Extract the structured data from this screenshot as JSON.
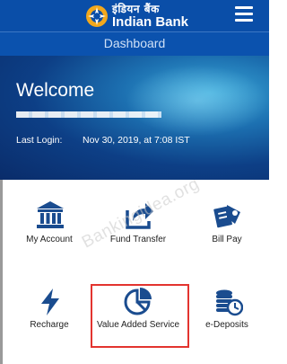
{
  "header": {
    "logo_hindi": "इंडियन बैंक",
    "logo_english": "Indian Bank",
    "menu_icon": "hamburger-menu-icon",
    "brand_color": "#0a4ea8"
  },
  "subheader": {
    "title": "Dashboard"
  },
  "hero": {
    "welcome_text": "Welcome",
    "last_login_label": "Last Login:",
    "last_login_value": "Nov 30, 2019, at 7:08 IST"
  },
  "tiles": [
    {
      "label": "My Account",
      "icon": "bank-building-icon"
    },
    {
      "label": "Fund Transfer",
      "icon": "share-arrow-icon"
    },
    {
      "label": "Bill Pay",
      "icon": "bill-pay-icon"
    },
    {
      "label": "Recharge",
      "icon": "lightning-icon"
    },
    {
      "label": "Value Added Service",
      "icon": "pie-chart-icon"
    },
    {
      "label": "e-Deposits",
      "icon": "coins-clock-icon"
    }
  ],
  "watermark": "Bankingidea.org",
  "highlight_color": "#e3342f"
}
